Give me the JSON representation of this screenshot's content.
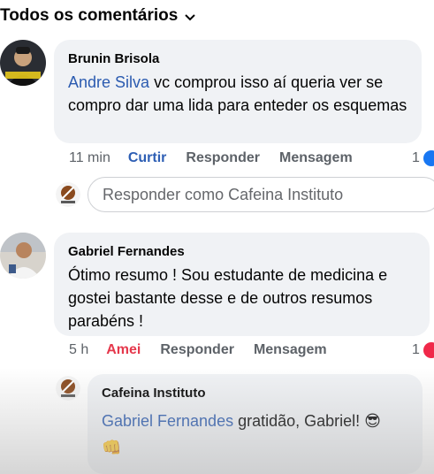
{
  "header": {
    "title": "Todos os comentários",
    "chevron_icon": "chevron-down-icon"
  },
  "comments": [
    {
      "author": "Brunin Brisola",
      "mention": "Andre Silva",
      "text_after_mention": " vc comprou isso aí queria ver se compro dar uma lida para enteder os esquemas",
      "time": "11 min",
      "like_label": "Curtir",
      "reply_label": "Responder",
      "message_label": "Mensagem",
      "reaction_count": "1",
      "reaction_type": "like",
      "reaction_color": "#1877f2"
    },
    {
      "author": "Gabriel Fernandes",
      "text": "Ótimo resumo ! Sou estudante de medicina e gostei bastante desse e de outros resumos parabéns !",
      "time": "5 h",
      "like_label": "Amei",
      "reply_label": "Responder",
      "message_label": "Mensagem",
      "reaction_count": "1",
      "reaction_type": "love",
      "reaction_color": "#f02849"
    }
  ],
  "reply_box": {
    "placeholder": "Responder como Cafeina Instituto"
  },
  "reply": {
    "author": "Cafeina Instituto",
    "mention": "Gabriel Fernandes",
    "text_after_mention": " gratidão, Gabriel! 😎",
    "emoji_line": "👊"
  }
}
